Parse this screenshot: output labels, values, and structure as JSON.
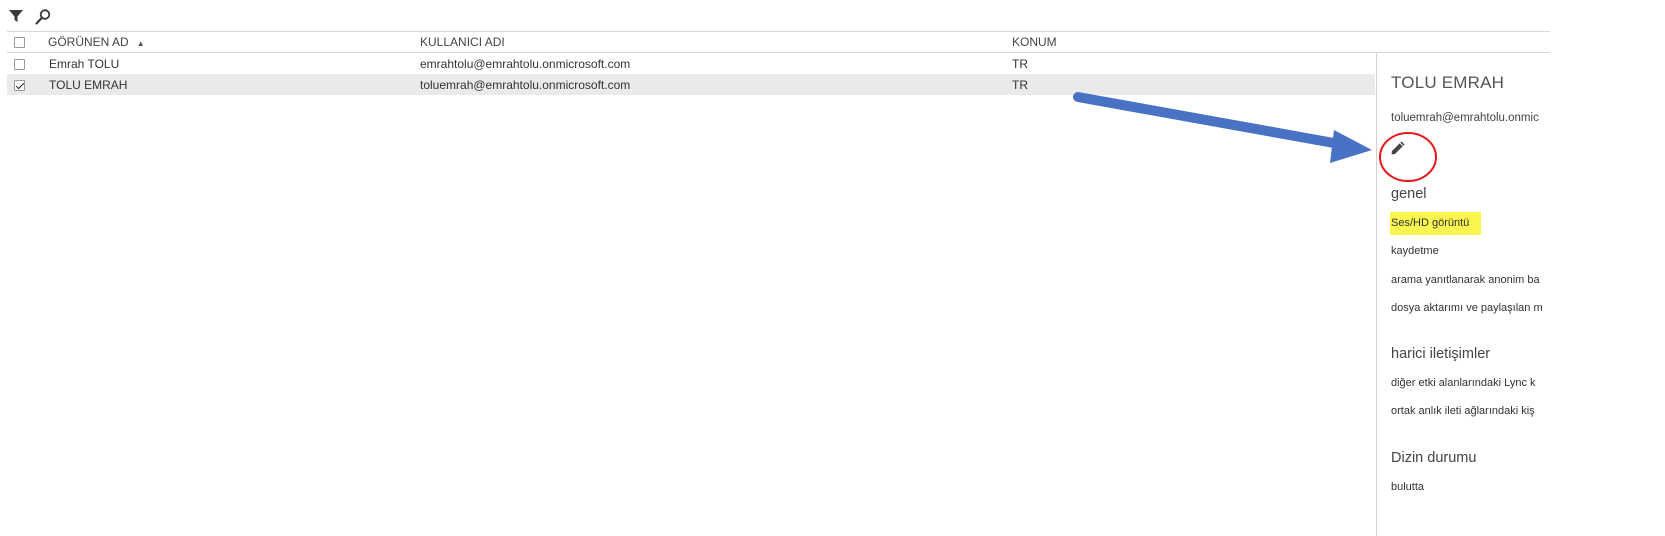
{
  "toolbar": {
    "filter_icon": "filter-icon",
    "search_icon": "search-icon"
  },
  "table": {
    "columns": [
      "GÖRÜNEN AD",
      "KULLANICI ADI",
      "KONUM"
    ],
    "sort_indicator": "▲",
    "rows": [
      {
        "display_name": "Emrah TOLU",
        "user_name": "emrahtolu@emrahtolu.onmicrosoft.com",
        "location": "TR",
        "selected": false
      },
      {
        "display_name": "TOLU EMRAH",
        "user_name": "toluemrah@emrahtolu.onmicrosoft.com",
        "location": "TR",
        "selected": true
      }
    ]
  },
  "panel": {
    "title": "TOLU EMRAH",
    "email": "toluemrah@emrahtolu.onmic",
    "edit_icon": "pencil-icon",
    "sections": [
      {
        "heading": "genel",
        "items": [
          "Ses/HD görüntü",
          "kaydetme",
          "arama yanıtlanarak anonim ba",
          "dosya aktarımı ve paylaşılan m"
        ]
      },
      {
        "heading": "harici iletişimler",
        "items": [
          "diğer etki alanlarındaki Lync k",
          "ortak anlık ileti ağlarındaki kiş"
        ]
      },
      {
        "heading": "Dizin durumu",
        "items": [
          "bulutta"
        ]
      }
    ]
  },
  "annotation": {
    "arrow_color": "#4a72c4",
    "circle_color": "#e0191b",
    "highlight_color": "#f8f64f"
  }
}
